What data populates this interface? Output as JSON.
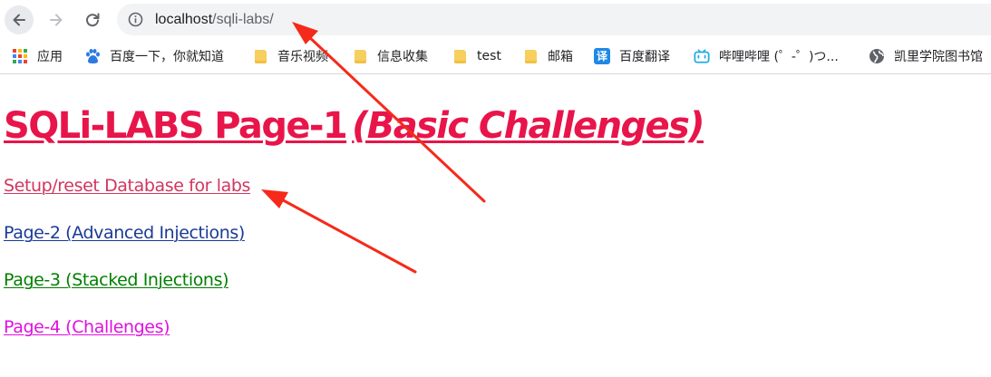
{
  "browser": {
    "url_host": "localhost",
    "url_path": "/sqli-labs/",
    "bookmarks": [
      {
        "label": "应用",
        "icon": "apps-grid-icon"
      },
      {
        "label": "百度一下，你就知道",
        "icon": "baidu-paw-icon"
      },
      {
        "label": "音乐视频",
        "icon": "folder-icon"
      },
      {
        "label": "信息收集",
        "icon": "folder-icon"
      },
      {
        "label": "test",
        "icon": "folder-icon"
      },
      {
        "label": "邮箱",
        "icon": "folder-icon"
      },
      {
        "label": "百度翻译",
        "icon": "translate-icon",
        "glyph": "译"
      },
      {
        "label": "哔哩哔哩 (゜-゜)つ...",
        "icon": "bilibili-icon"
      },
      {
        "label": "凯里学院图书馆",
        "icon": "globe-icon"
      }
    ]
  },
  "page": {
    "title": "SQLi-LABS Page-1",
    "subtitle": "(Basic Challenges)",
    "links": [
      {
        "label": "Setup/reset Database for labs",
        "color": "#d0365e"
      },
      {
        "label": "Page-2 (Advanced Injections)",
        "color": "#1a3a96"
      },
      {
        "label": "Page-3 (Stacked Injections)",
        "color": "#008000"
      },
      {
        "label": "Page-4 (Challenges)",
        "color": "#e010e0"
      }
    ],
    "title_color": "#e8154a"
  },
  "annotation": {
    "arrow_color": "#f52a1a"
  }
}
